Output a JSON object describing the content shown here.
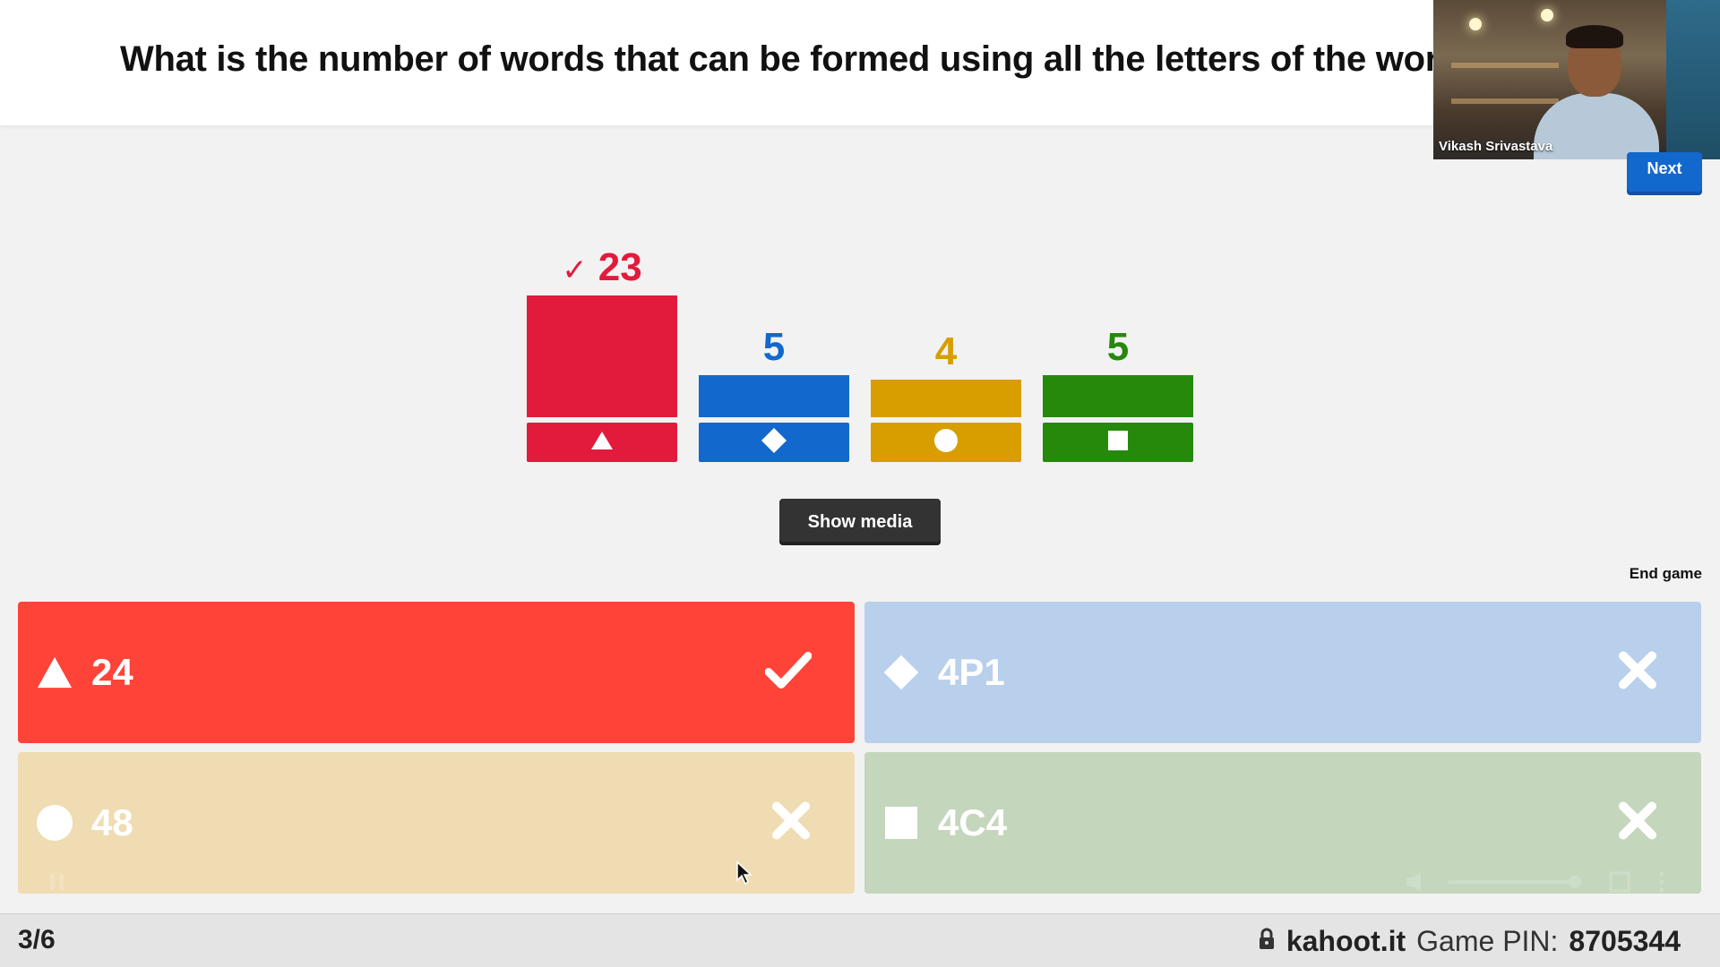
{
  "question": {
    "text": "What is the number of words that can be formed using all the letters of the wor"
  },
  "webcam": {
    "name": "Vikash Srivastava"
  },
  "controls": {
    "next_label": "Next",
    "show_media_label": "Show media",
    "end_game_label": "End game"
  },
  "chart_data": {
    "type": "bar",
    "categories": [
      "triangle",
      "diamond",
      "circle",
      "square"
    ],
    "values": [
      23,
      5,
      4,
      5
    ],
    "colors": [
      "#e21b3c",
      "#1368ce",
      "#d89e00",
      "#26890c"
    ],
    "correct": [
      true,
      false,
      false,
      false
    ],
    "check_symbol": "✓"
  },
  "answers": [
    {
      "shape": "triangle-icon",
      "label": "24",
      "correct": true,
      "color": "#fe4338",
      "mark": "check-icon"
    },
    {
      "shape": "diamond-icon",
      "label": "4P1",
      "correct": false,
      "color": "#b9d0ec",
      "mark": "close-icon"
    },
    {
      "shape": "circle-icon",
      "label": "48",
      "correct": false,
      "color": "#f0dcb2",
      "mark": "close-icon"
    },
    {
      "shape": "square-icon",
      "label": "4C4",
      "correct": false,
      "color": "#c4d6bc",
      "mark": "close-icon"
    }
  ],
  "footer": {
    "progress": "3/6",
    "site": "kahoot.it",
    "pin_label": "Game PIN:",
    "pin_value": "8705344"
  }
}
